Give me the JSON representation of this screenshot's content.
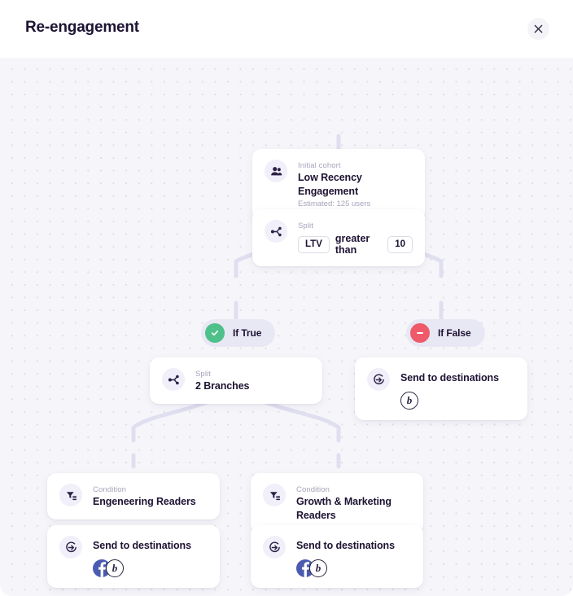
{
  "header": {
    "title": "Re-engagement",
    "close_label": "×",
    "close_icon": "close-icon"
  },
  "canvas": {
    "background_color": "#f6f6fa",
    "dot_color": "#dddde6",
    "edge_color": "#e0dff0"
  },
  "colors": {
    "accent": "#4a5bb0",
    "true_badge": "#4ec08a",
    "false_badge": "#ef5a6a",
    "text_primary": "#1d1333",
    "text_muted": "#a6a4bb",
    "icon_bubble": "#f1eff9",
    "pill_bg": "#e8e7f4"
  },
  "nodes": {
    "cohort": {
      "icon": "users-icon",
      "kicker": "Initial cohort",
      "title": "Low Recency Engagement",
      "subtitle": "Estimated: 125 users"
    },
    "split_top": {
      "icon": "split-icon",
      "kicker": "Split",
      "field": "LTV",
      "operator": "greater than",
      "value": "10"
    },
    "branch_true": {
      "icon": "check-circle-icon",
      "label": "If True"
    },
    "branch_false": {
      "icon": "minus-circle-icon",
      "label": "If False"
    },
    "split_branches": {
      "icon": "split-icon",
      "kicker": "Split",
      "title": "2 Branches"
    },
    "dest_false": {
      "icon": "send-icon",
      "title": "Send to destinations",
      "logos": [
        "braze-logo"
      ]
    },
    "condition_left": {
      "icon": "filter-icon",
      "kicker": "Condition",
      "title": "Engeneering Readers"
    },
    "condition_right": {
      "icon": "filter-icon",
      "kicker": "Condition",
      "title": "Growth & Marketing Readers"
    },
    "dest_left": {
      "icon": "send-icon",
      "title": "Send to destinations",
      "logos": [
        "facebook-logo",
        "braze-logo"
      ]
    },
    "dest_right": {
      "icon": "send-icon",
      "title": "Send to destinations",
      "logos": [
        "facebook-logo",
        "braze-logo"
      ]
    }
  }
}
